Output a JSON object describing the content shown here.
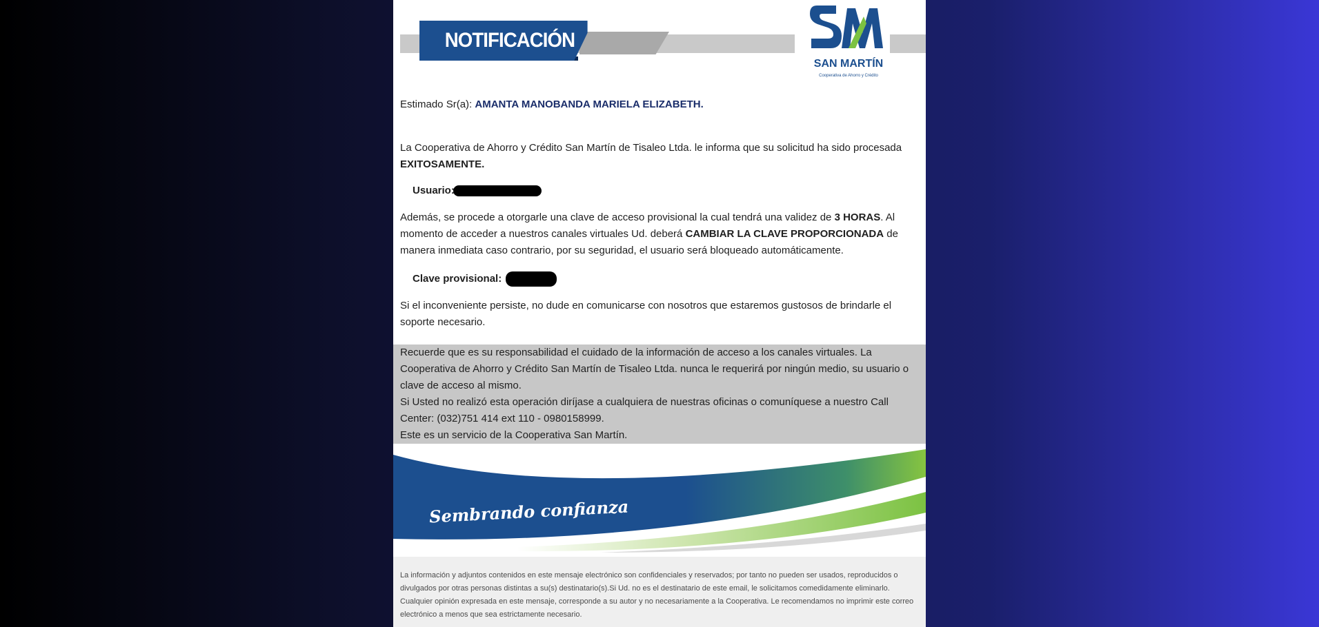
{
  "header": {
    "banner_title": "NOTIFICACIÓN",
    "logo": {
      "monogram": "SM",
      "name": "SAN MARTÍN",
      "subtitle": "Cooperativa de Ahorro y Crédito"
    }
  },
  "greeting": {
    "label": "Estimado Sr(a):",
    "name": "AMANTA MANOBANDA MARIELA ELIZABETH."
  },
  "paragraph1": {
    "text": "La Cooperativa de Ahorro y Crédito San Martín de Tisaleo Ltda. le informa que su solicitud ha sido procesada ",
    "emphasis": "EXITOSAMENTE."
  },
  "usuario": {
    "label": "Usuario:"
  },
  "paragraph2": {
    "part1": "Además, se procede a otorgarle una clave de acceso provisional la cual tendrá una validez de ",
    "bold1": "3 HORAS",
    "part2": ". Al momento de acceder a nuestros canales virtuales Ud. deberá ",
    "bold2": "CAMBIAR LA CLAVE PROPORCIONADA",
    "part3": " de manera inmediata caso contrario, por su seguridad, el usuario será bloqueado automáticamente."
  },
  "clave": {
    "label": "Clave provisional:"
  },
  "paragraph3": "Si el inconveniente persiste, no dude en comunicarse con nosotros que estaremos gustosos de brindarle el soporte necesario.",
  "notice": {
    "line1": "Recuerde que es su responsabilidad el cuidado de la información de acceso a los canales virtuales. La Cooperativa de Ahorro y Crédito San Martín de Tisaleo Ltda. nunca le requerirá por ningún medio, su usuario o clave de acceso al mismo.",
    "line2": "Si Usted no realizó esta operación diríjase a cualquiera de nuestras oficinas o comuníquese a nuestro Call Center: (032)751 414 ext 110 - 0980158999.",
    "line3": "Este es un servicio de la Cooperativa San Martín."
  },
  "footer": {
    "slogan": "Sembrando confianza",
    "disclaimer": "La información y adjuntos contenidos en este mensaje electrónico son confidenciales y reservados; por tanto no pueden ser usados, reproducidos o divulgados por otras personas distintas a su(s) destinatario(s).Si Ud. no es el destinatario de este email, le solicitamos comedidamente eliminarlo. Cualquier opinión expresada en este mensaje, corresponde a su autor y no necesariamente a la Cooperativa. Le recomendamos no imprimir este correo electrónico a menos que sea estrictamente necesario."
  },
  "colors": {
    "brand_blue": "#1c4f8f",
    "brand_green": "#7cc242",
    "notice_bg": "#c7c7c7"
  }
}
